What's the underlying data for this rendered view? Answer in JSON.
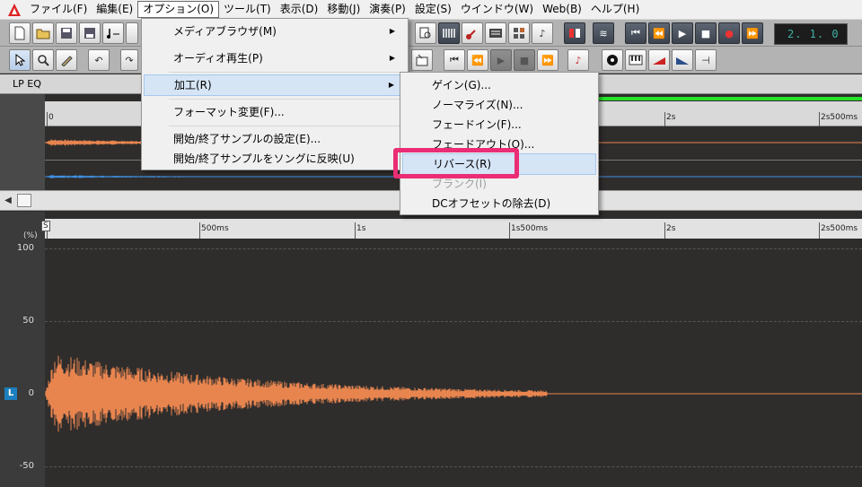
{
  "menubar": {
    "items": [
      "ファイル(F)",
      "編集(E)",
      "オプション(O)",
      "ツール(T)",
      "表示(D)",
      "移動(J)",
      "演奏(P)",
      "設定(S)",
      "ウインドウ(W)",
      "Web(B)",
      "ヘルプ(H)"
    ],
    "open_item": "オプション(O)"
  },
  "transport": {
    "counter": "2. 1.  0"
  },
  "track": {
    "name": "LP EQ"
  },
  "overview_ruler": {
    "ticks": [
      "0",
      "2s",
      "2s500ms"
    ]
  },
  "zoom_ruler": {
    "ticks": [
      "0",
      "500ms",
      "1s",
      "1s500ms",
      "2s",
      "2s500ms"
    ]
  },
  "waveform": {
    "unit_label": "(%)",
    "y_ticks": [
      "100",
      "50",
      "0",
      "-50"
    ],
    "channel_badge": "L",
    "color": "#e8854f",
    "overview_right_channel_color": "#3f8fe0"
  },
  "option_menu": {
    "items": [
      {
        "label": "メディアブラウザ(M)",
        "submenu": true
      },
      {
        "label": "オーディオ再生(P)",
        "submenu": true
      },
      {
        "label": "加工(R)",
        "submenu": true,
        "highlighted": true
      },
      {
        "label": "フォーマット変更(F)...",
        "submenu": false
      },
      {
        "label": "開始/終了サンプルの設定(E)...",
        "submenu": false
      },
      {
        "label": "開始/終了サンプルをソングに反映(U)",
        "submenu": false
      }
    ]
  },
  "process_submenu": {
    "items": [
      {
        "label": "ゲイン(G)...",
        "disabled": false
      },
      {
        "label": "ノーマライズ(N)...",
        "disabled": false
      },
      {
        "label": "フェードイン(F)...",
        "disabled": false
      },
      {
        "label": "フェードアウト(O)...",
        "disabled": false
      },
      {
        "label": "リバース(R)",
        "disabled": false,
        "highlighted": true
      },
      {
        "label": "ブランク(I)",
        "disabled": true
      },
      {
        "label": "DCオフセットの除去(D)",
        "disabled": false
      }
    ]
  },
  "colors": {
    "annotation": "#ea2d74",
    "accent_green": "#26e326"
  }
}
